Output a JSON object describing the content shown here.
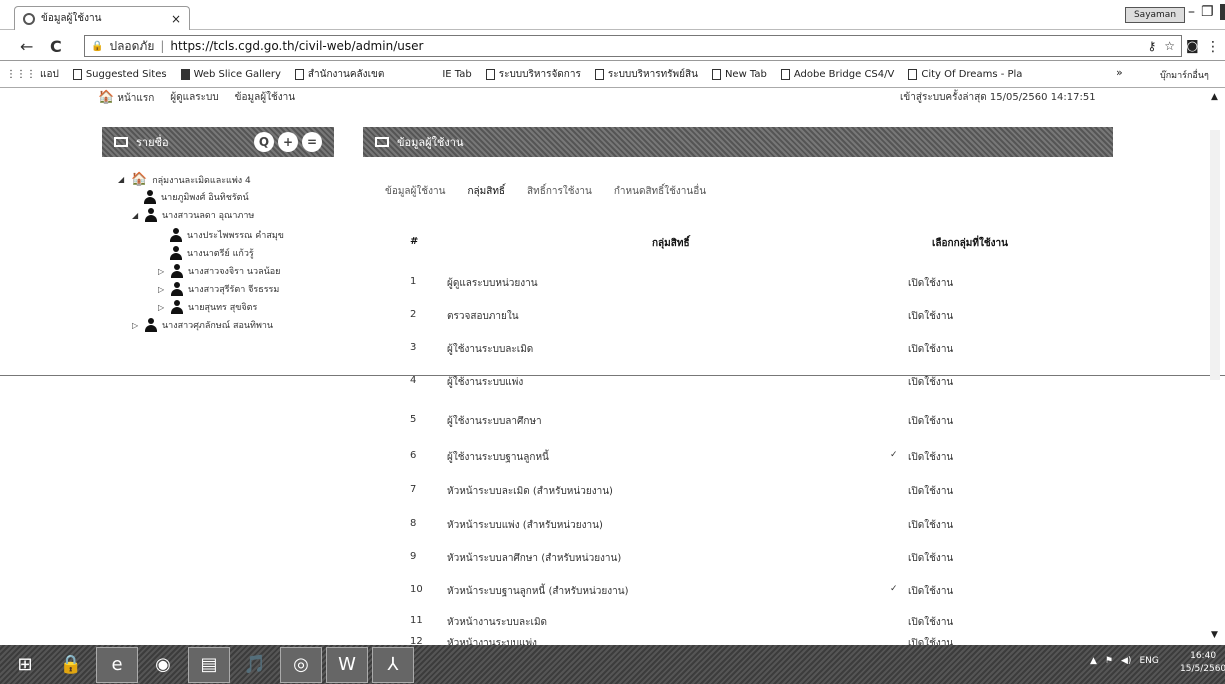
{
  "browser": {
    "tab_title": "ข้อมูลผู้ใช้งาน",
    "tab_close": "×",
    "user_button": "Sayaman",
    "win_min": "–",
    "win_max": "❐",
    "win_close": "✕",
    "back": "←",
    "reload": "C",
    "secure_label": "ปลอดภัย",
    "url": "https://tcls.cgd.go.th/civil-web/admin/user",
    "omnibox_key": "⚷",
    "omnibox_star": "☆",
    "ext_icon": "◙",
    "menu": "⋮"
  },
  "bookmarks": {
    "apps": "แอป",
    "items": [
      "Suggested Sites",
      "Web Slice Gallery",
      "สำนักงานคลังเขต",
      "IE Tab",
      "ระบบบริหารจัดการ",
      "ระบบบริหารทรัพย์สิน",
      "New Tab",
      "Adobe Bridge CS4/V",
      "City Of Dreams - Pla"
    ],
    "more": "»",
    "other": "บุ๊กมาร์กอื่นๆ"
  },
  "topnav": {
    "items": [
      "หน้าแรก",
      "ผู้ดูแลระบบ",
      "ข้อมูลผู้ใช้งาน"
    ],
    "login_time": "เข้าสู่ระบบครั้งล่าสุด 15/05/2560 14:17:51"
  },
  "left_panel": {
    "title": "รายชื่อ",
    "tools": [
      "Q",
      "+",
      "="
    ],
    "tree": [
      {
        "label": "กลุ่มงานละเมิดและแพ่ง 4",
        "toggle": "◢",
        "type": "home"
      },
      {
        "label": "นายภูมิพงศ์ อินทิชรัตน์",
        "toggle": "",
        "type": "person"
      },
      {
        "label": "นางสาวนลดา อุณาภาษ",
        "toggle": "◢",
        "type": "person"
      },
      {
        "label": "นางประไพพรรณ คำสมุข",
        "toggle": "",
        "type": "person"
      },
      {
        "label": "นางนาตรีย์ แก้วรู้",
        "toggle": "",
        "type": "person"
      },
      {
        "label": "นางสาวจงจิรา นวลน้อย",
        "toggle": "▷",
        "type": "person"
      },
      {
        "label": "นางสาวสุรีรัตา จีรธรรม",
        "toggle": "▷",
        "type": "person"
      },
      {
        "label": "นายสุนทร สุขจิตร",
        "toggle": "▷",
        "type": "person"
      },
      {
        "label": "นางสาวศุภลักษณ์ สอนทิพาน",
        "toggle": "▷",
        "type": "person"
      }
    ]
  },
  "main": {
    "title": "ข้อมูลผู้ใช้งาน",
    "subtabs": [
      "ข้อมูลผู้ใช้งาน",
      "กลุ่มสิทธิ์",
      "สิทธิ์การใช้งาน",
      "กำหนดสิทธิ์ใช้งานอื่น"
    ],
    "columns": [
      "#",
      "กลุ่มสิทธิ์",
      "เลือกกลุ่มที่ใช้งาน"
    ],
    "rows": [
      {
        "num": "1",
        "name": "ผู้ดูแลระบบหน่วยงาน",
        "status": "เปิดใช้งาน",
        "check": ""
      },
      {
        "num": "2",
        "name": "ตรวจสอบภายใน",
        "status": "เปิดใช้งาน",
        "check": ""
      },
      {
        "num": "3",
        "name": "ผู้ใช้งานระบบละเมิด",
        "status": "เปิดใช้งาน",
        "check": ""
      },
      {
        "num": "4",
        "name": "ผู้ใช้งานระบบแพ่ง",
        "status": "เปิดใช้งาน",
        "check": ""
      },
      {
        "num": "5",
        "name": "ผู้ใช้งานระบบลาศึกษา",
        "status": "เปิดใช้งาน",
        "check": ""
      },
      {
        "num": "6",
        "name": "ผู้ใช้งานระบบฐานลูกหนี้",
        "status": "เปิดใช้งาน",
        "check": "✓"
      },
      {
        "num": "7",
        "name": "หัวหน้าระบบละเมิด (สำหรับหน่วยงาน)",
        "status": "เปิดใช้งาน",
        "check": ""
      },
      {
        "num": "8",
        "name": "หัวหน้าระบบแพ่ง (สำหรับหน่วยงาน)",
        "status": "เปิดใช้งาน",
        "check": ""
      },
      {
        "num": "9",
        "name": "หัวหน้าระบบลาศึกษา (สำหรับหน่วยงาน)",
        "status": "เปิดใช้งาน",
        "check": ""
      },
      {
        "num": "10",
        "name": "หัวหน้าระบบฐานลูกหนี้ (สำหรับหน่วยงาน)",
        "status": "เปิดใช้งาน",
        "check": "✓"
      },
      {
        "num": "11",
        "name": "หัวหน้างานระบบละเมิด",
        "status": "เปิดใช้งาน",
        "check": ""
      },
      {
        "num": "12",
        "name": "หัวหน้างานระบบแพ่ง",
        "status": "เปิดใช้งาน",
        "check": ""
      }
    ]
  },
  "taskbar": {
    "start": "⊞",
    "apps": [
      "🔒",
      "e",
      "◉",
      "▤",
      "🎵",
      "◎",
      "W",
      "⅄"
    ],
    "tray": [
      "▲",
      "⚑",
      "◀)",
      "ENG"
    ],
    "time": "16:40",
    "date": "15/5/2560"
  }
}
